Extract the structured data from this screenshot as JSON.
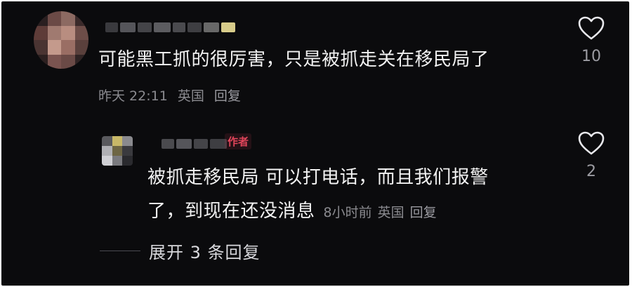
{
  "comment": {
    "text": "可能黑工抓的很厉害，只是被抓走关在移民局了",
    "meta": {
      "time": "昨天 22:11",
      "location": "英国",
      "reply_label": "回复"
    },
    "like_count": "10",
    "avatar_colors": [
      "#2a1f20",
      "#6b4a46",
      "#8c6a62",
      "#3a2a2a",
      "#5e3c38",
      "#a07a70",
      "#b88d80",
      "#6d4d48",
      "#4a3432",
      "#c49a8c",
      "#9a6e64",
      "#5a403c",
      "#2c2020",
      "#7a5450",
      "#6a4a46",
      "#302424"
    ],
    "name_colors": [
      "#3a3a3e",
      "#55555a",
      "#444448",
      "#5c5c60",
      "#4a4a4e",
      "#3e3e42",
      "#686868",
      "#d8cc8a"
    ]
  },
  "reply": {
    "author_badge": "作者",
    "text_line1": "被抓走移民局   可以打电话，而且我们报警",
    "text_line2": "了，到现在还没消息",
    "meta": {
      "time": "8小时前",
      "location": "英国",
      "reply_label": "回复"
    },
    "like_count": "2",
    "avatar_colors": [
      "#5a5a5e",
      "#c8b868",
      "#8a8a8e",
      "#b0b0b4",
      "#6e6644",
      "#3a3a3e",
      "#d0d0d4",
      "#7a7a7e",
      "#2a2a2e"
    ],
    "name_colors": [
      "#4a4a4e",
      "#55555a",
      "#444448",
      "#3e3e42"
    ]
  },
  "expand": {
    "label": "展开 3 条回复"
  },
  "icons": {
    "like": "heart-outline-icon"
  },
  "colors": {
    "background": "#0b0b0d",
    "text": "#f2f2f2",
    "meta": "#8a8a8f",
    "author": "#e0455a"
  }
}
